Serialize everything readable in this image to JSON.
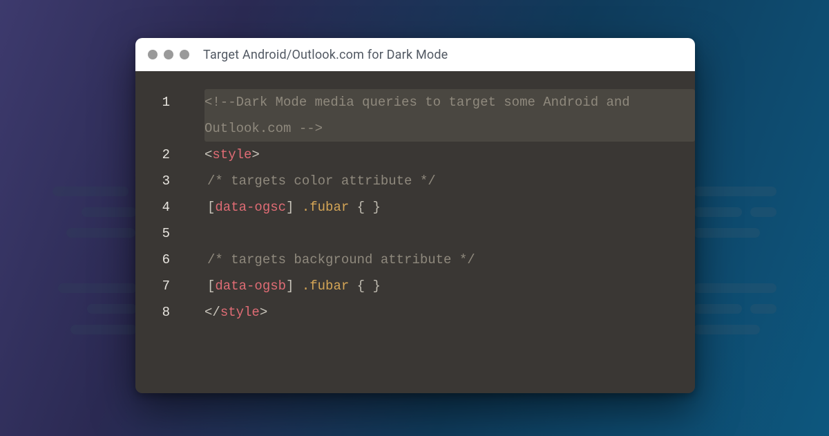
{
  "window": {
    "title": "Target Android/Outlook.com for Dark Mode"
  },
  "code": {
    "l1": "<!--Dark Mode media queries to target some Android and Outlook.com -->",
    "l2_open": "<",
    "l2_tag": "style",
    "l2_close": ">",
    "l3": "/* targets color attribute */",
    "l4_br_o": "[",
    "l4_attr": "data-ogsc",
    "l4_br_c": "]",
    "l4_sel": " .fubar ",
    "l4_braces": "{ }",
    "l6": "/* targets background attribute */",
    "l7_br_o": "[",
    "l7_attr": "data-ogsb",
    "l7_br_c": "]",
    "l7_sel": " .fubar ",
    "l7_braces": "{ }",
    "l8_open": "</",
    "l8_tag": "style",
    "l8_close": ">"
  },
  "lines": {
    "n1": "1",
    "n2": "2",
    "n3": "3",
    "n4": "4",
    "n5": "5",
    "n6": "6",
    "n7": "7",
    "n8": "8"
  }
}
